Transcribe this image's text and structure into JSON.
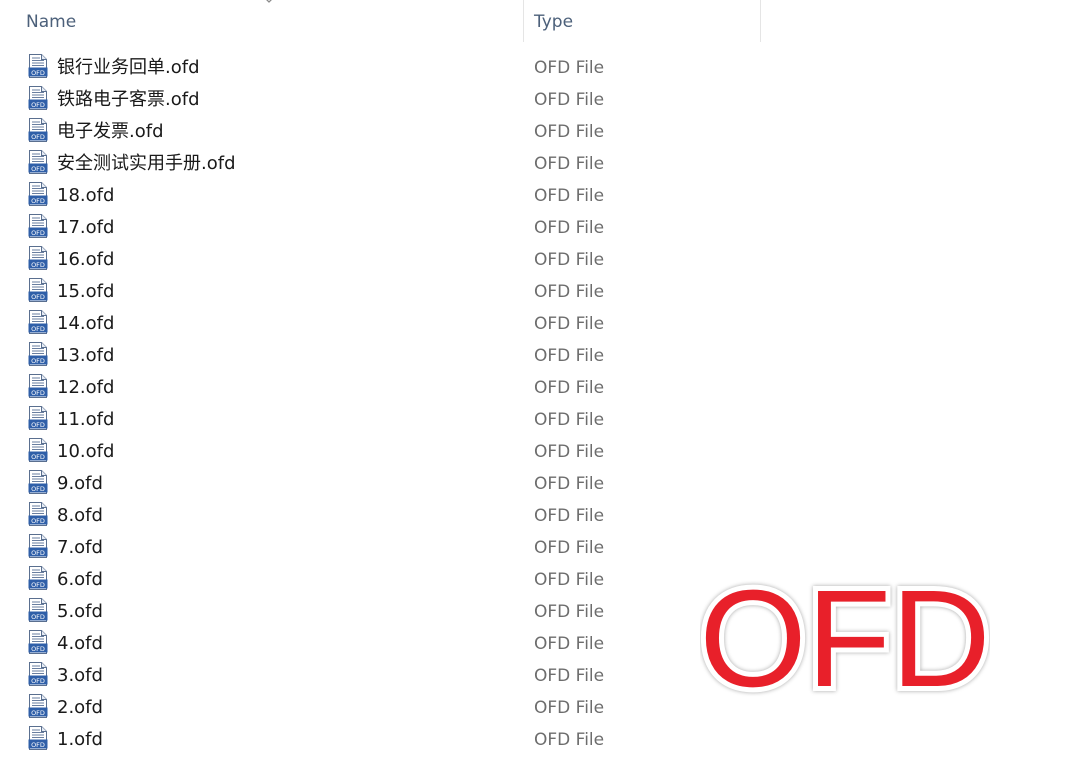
{
  "header": {
    "name_label": "Name",
    "type_label": "Type",
    "sort_icon": "chevron-down-icon"
  },
  "files": [
    {
      "name": "银行业务回单.ofd",
      "type": "OFD File"
    },
    {
      "name": "铁路电子客票.ofd",
      "type": "OFD File"
    },
    {
      "name": "电子发票.ofd",
      "type": "OFD File"
    },
    {
      "name": "安全测试实用手册.ofd",
      "type": "OFD File"
    },
    {
      "name": "18.ofd",
      "type": "OFD File"
    },
    {
      "name": "17.ofd",
      "type": "OFD File"
    },
    {
      "name": "16.ofd",
      "type": "OFD File"
    },
    {
      "name": "15.ofd",
      "type": "OFD File"
    },
    {
      "name": "14.ofd",
      "type": "OFD File"
    },
    {
      "name": "13.ofd",
      "type": "OFD File"
    },
    {
      "name": "12.ofd",
      "type": "OFD File"
    },
    {
      "name": "11.ofd",
      "type": "OFD File"
    },
    {
      "name": "10.ofd",
      "type": "OFD File"
    },
    {
      "name": "9.ofd",
      "type": "OFD File"
    },
    {
      "name": "8.ofd",
      "type": "OFD File"
    },
    {
      "name": "7.ofd",
      "type": "OFD File"
    },
    {
      "name": "6.ofd",
      "type": "OFD File"
    },
    {
      "name": "5.ofd",
      "type": "OFD File"
    },
    {
      "name": "4.ofd",
      "type": "OFD File"
    },
    {
      "name": "3.ofd",
      "type": "OFD File"
    },
    {
      "name": "2.ofd",
      "type": "OFD File"
    },
    {
      "name": "1.ofd",
      "type": "OFD File"
    }
  ],
  "file_icon": {
    "name": "ofd-file-icon",
    "badge_text": "OFD",
    "badge_color": "#2f5fa8"
  },
  "watermark": {
    "text": "OFD",
    "color": "#e8202a"
  }
}
